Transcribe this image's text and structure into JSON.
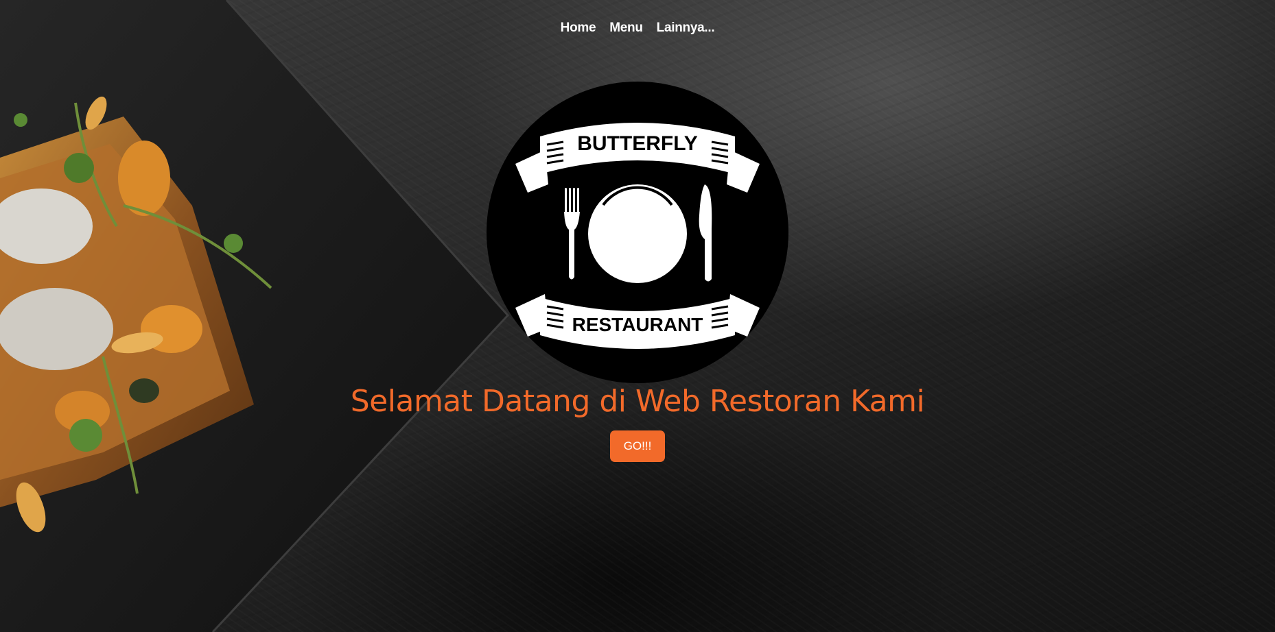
{
  "nav": {
    "items": [
      {
        "label": "Home"
      },
      {
        "label": "Menu"
      },
      {
        "label": "Lainnya..."
      }
    ]
  },
  "logo": {
    "top_text": "BUTTERFLY",
    "bottom_text": "RESTAURANT",
    "icons": [
      "fork-icon",
      "plate-icon",
      "knife-icon"
    ]
  },
  "hero": {
    "headline": "Selamat Datang di Web Restoran Kami",
    "button_label": "GO!!!"
  },
  "colors": {
    "accent": "#f26a2a",
    "background": "#1c1c1c",
    "logo_circle": "#000000",
    "logo_foreground": "#ffffff"
  }
}
